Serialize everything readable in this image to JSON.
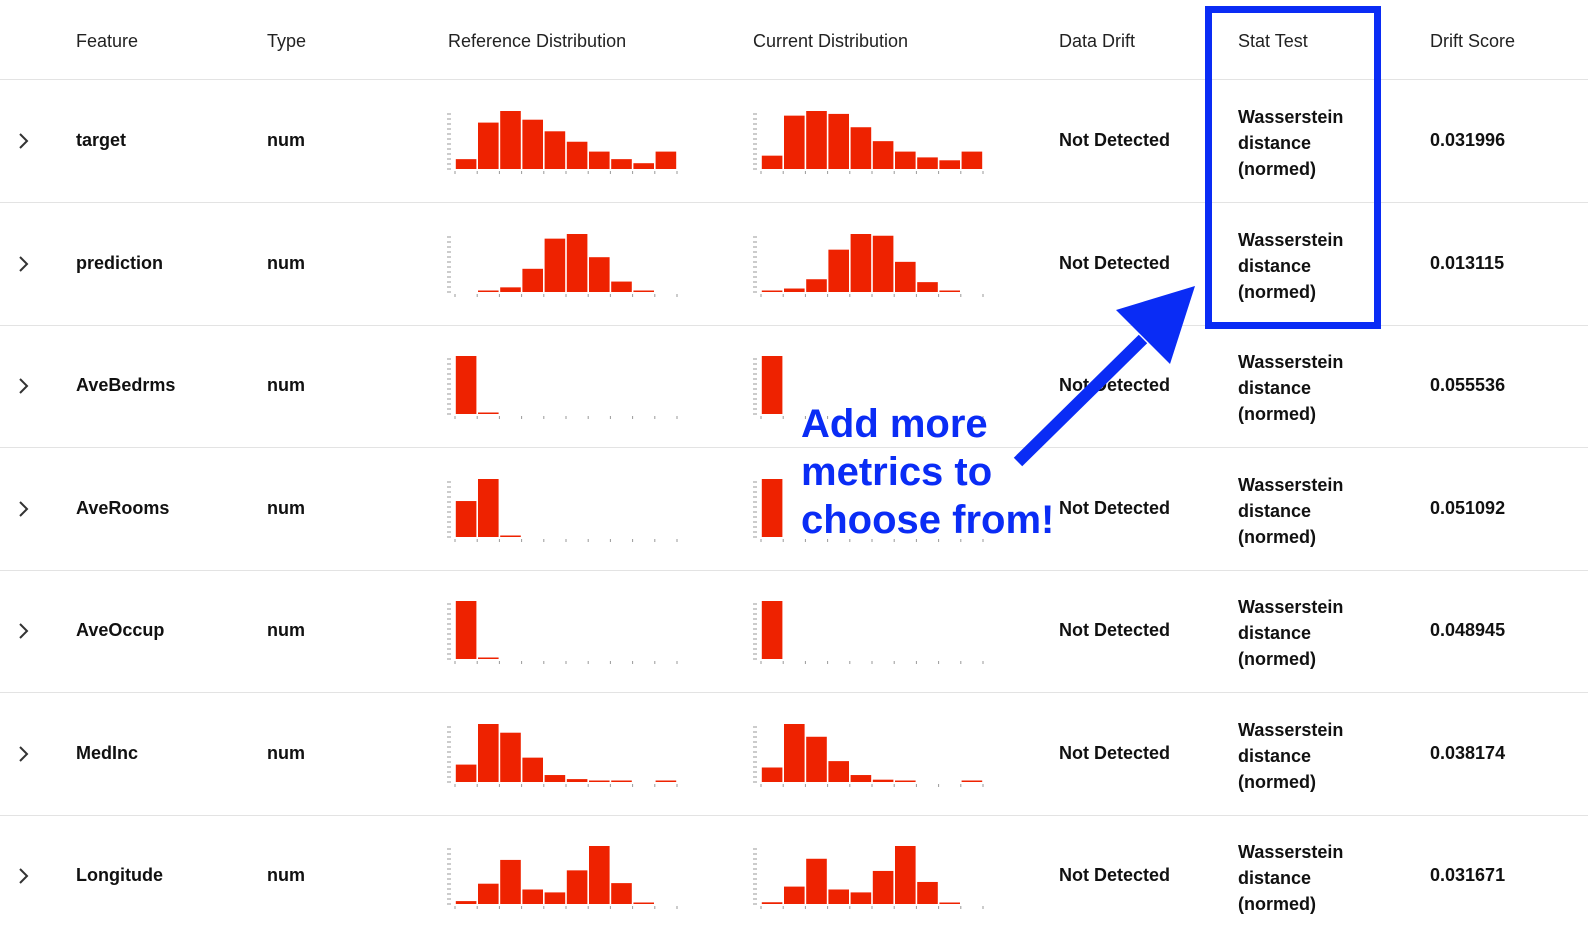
{
  "columns": {
    "feature": "Feature",
    "type": "Type",
    "reference": "Reference Distribution",
    "current": "Current Distribution",
    "drift": "Data Drift",
    "stat": "Stat Test",
    "score": "Drift Score"
  },
  "rows": [
    {
      "feature": "target",
      "type": "num",
      "drift": "Not Detected",
      "stat": [
        "Wasserstein",
        "distance",
        "(normed)"
      ],
      "score": "0.031996",
      "ref": [
        0.17,
        0.8,
        1.0,
        0.85,
        0.65,
        0.47,
        0.3,
        0.17,
        0.1,
        0.3
      ],
      "cur": [
        0.23,
        0.92,
        1.0,
        0.95,
        0.72,
        0.48,
        0.3,
        0.2,
        0.15,
        0.3
      ]
    },
    {
      "feature": "prediction",
      "type": "num",
      "drift": "Not Detected",
      "stat": [
        "Wasserstein",
        "distance",
        "(normed)"
      ],
      "score": "0.013115",
      "ref": [
        0,
        0.01,
        0.08,
        0.4,
        0.92,
        1.0,
        0.6,
        0.18,
        0.02,
        0
      ],
      "cur": [
        0.01,
        0.06,
        0.22,
        0.73,
        1.0,
        0.97,
        0.52,
        0.17,
        0.02,
        0
      ]
    },
    {
      "feature": "AveBedrms",
      "type": "num",
      "drift": "Not Detected",
      "stat": [
        "Wasserstein",
        "distance",
        "(normed)"
      ],
      "score": "0.055536",
      "ref": [
        1.0,
        0.02,
        0,
        0,
        0,
        0,
        0,
        0,
        0,
        0
      ],
      "cur": [
        1.0,
        0,
        0,
        0,
        0,
        0,
        0,
        0,
        0,
        0
      ]
    },
    {
      "feature": "AveRooms",
      "type": "num",
      "drift": "Not Detected",
      "stat": [
        "Wasserstein",
        "distance",
        "(normed)"
      ],
      "score": "0.051092",
      "ref": [
        0.62,
        1.0,
        0.02,
        0,
        0,
        0,
        0,
        0,
        0,
        0
      ],
      "cur": [
        1.0,
        0,
        0,
        0,
        0,
        0,
        0,
        0,
        0,
        0
      ]
    },
    {
      "feature": "AveOccup",
      "type": "num",
      "drift": "Not Detected",
      "stat": [
        "Wasserstein",
        "distance",
        "(normed)"
      ],
      "score": "0.048945",
      "ref": [
        1.0,
        0.02,
        0,
        0,
        0,
        0,
        0,
        0,
        0,
        0
      ],
      "cur": [
        1.0,
        0,
        0,
        0,
        0,
        0,
        0,
        0,
        0,
        0
      ]
    },
    {
      "feature": "MedInc",
      "type": "num",
      "drift": "Not Detected",
      "stat": [
        "Wasserstein",
        "distance",
        "(normed)"
      ],
      "score": "0.038174",
      "ref": [
        0.3,
        1.0,
        0.85,
        0.42,
        0.12,
        0.05,
        0.02,
        0.01,
        0,
        0.02
      ],
      "cur": [
        0.25,
        1.0,
        0.78,
        0.36,
        0.12,
        0.04,
        0.02,
        0,
        0,
        0.02
      ]
    },
    {
      "feature": "Longitude",
      "type": "num",
      "drift": "Not Detected",
      "stat": [
        "Wasserstein",
        "distance",
        "(normed)"
      ],
      "score": "0.031671",
      "ref": [
        0.05,
        0.35,
        0.76,
        0.25,
        0.2,
        0.58,
        1.0,
        0.36,
        0.02,
        0
      ],
      "cur": [
        0.03,
        0.3,
        0.78,
        0.25,
        0.2,
        0.57,
        1.0,
        0.38,
        0.02,
        0
      ]
    }
  ],
  "annotation": {
    "lines": [
      "Add more",
      "metrics to",
      "choose from!"
    ],
    "color": "#0a2cf5"
  },
  "colors": {
    "bar": "#ee2200",
    "axis": "#9a9a9a"
  },
  "icons": {
    "expand": "chevron-right-icon"
  }
}
